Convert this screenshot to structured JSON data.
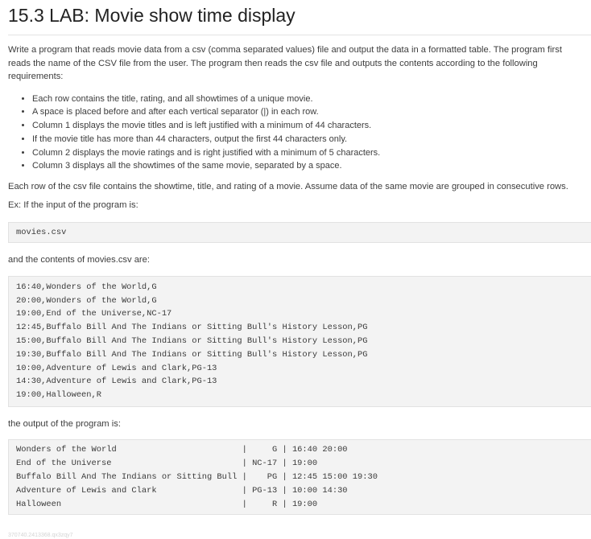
{
  "title": "15.3 LAB: Movie show time display",
  "intro": "Write a program that reads movie data from a csv (comma separated values) file and output the data in a formatted table. The program first reads the name of the CSV file from the user. The program then reads the csv file and outputs the contents according to the following requirements:",
  "requirements": [
    "Each row contains the title, rating, and all showtimes of a unique movie.",
    "A space is placed before and after each vertical separator (|) in each row.",
    "Column 1 displays the movie titles and is left justified with a minimum of 44 characters.",
    "If the movie title has more than 44 characters, output the first 44 characters only.",
    "Column 2 displays the movie ratings and is right justified with a minimum of 5 characters.",
    "Column 3 displays all the showtimes of the same movie, separated by a space."
  ],
  "para2": "Each row of the csv file contains the showtime, title, and rating of a movie. Assume data of the same movie are grouped in consecutive rows.",
  "example_label": "Ex: If the input of the program is:",
  "input_value": "movies.csv",
  "csv_label": "and the contents of movies.csv are:",
  "csv_lines": [
    "16:40,Wonders of the World,G",
    "20:00,Wonders of the World,G",
    "19:00,End of the Universe,NC-17",
    "12:45,Buffalo Bill And The Indians or Sitting Bull's History Lesson,PG",
    "15:00,Buffalo Bill And The Indians or Sitting Bull's History Lesson,PG",
    "19:30,Buffalo Bill And The Indians or Sitting Bull's History Lesson,PG",
    "10:00,Adventure of Lewis and Clark,PG-13",
    "14:30,Adventure of Lewis and Clark,PG-13",
    "19:00,Halloween,R"
  ],
  "output_label": "the output of the program is:",
  "output_lines": [
    "Wonders of the World                         |     G | 16:40 20:00",
    "End of the Universe                          | NC-17 | 19:00",
    "Buffalo Bill And The Indians or Sitting Bull |    PG | 12:45 15:00 19:30",
    "Adventure of Lewis and Clark                 | PG-13 | 10:00 14:30",
    "Halloween                                    |     R | 19:00"
  ],
  "footer_id": "370740.2413368.qx3zqy7"
}
